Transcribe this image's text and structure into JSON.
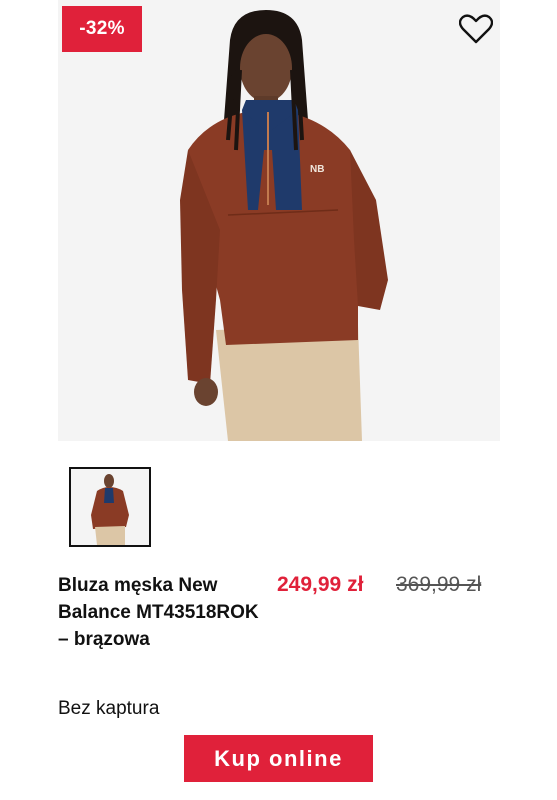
{
  "product": {
    "discount_badge": "-32%",
    "title": "Bluza męska New Balance MT43518ROK – brązowa",
    "price_current": "249,99 zł",
    "price_old": "369,99 zł",
    "variant": "Bez kaptura",
    "buy_label": "Kup online",
    "favorite_icon": "heart-outline-icon"
  },
  "colors": {
    "accent": "#e0213a",
    "sweater": "#8a3b25",
    "collar": "#1f3a6b",
    "pants": "#dcc6a6"
  }
}
